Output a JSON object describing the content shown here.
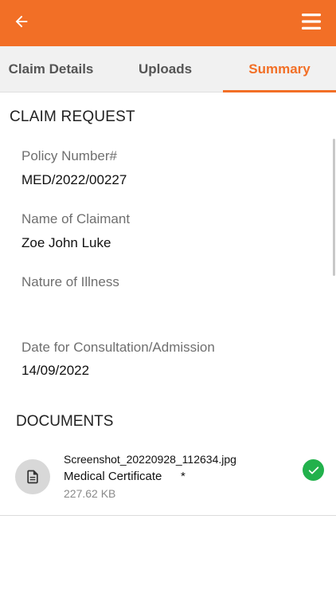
{
  "colors": {
    "brand": "#f26f26",
    "tab_bar": "#f1f1f1",
    "success": "#22b14c"
  },
  "appbar": {
    "back_icon": "arrow-left-icon",
    "menu_icon": "hamburger-menu-icon"
  },
  "tabs": [
    {
      "label": "Claim Details",
      "active": false
    },
    {
      "label": "Uploads",
      "active": false
    },
    {
      "label": "Summary",
      "active": true
    }
  ],
  "claim_request": {
    "title": "CLAIM REQUEST",
    "fields": [
      {
        "label": "Policy Number#",
        "value": "MED/2022/00227"
      },
      {
        "label": "Name of Claimant",
        "value": "Zoe John Luke"
      },
      {
        "label": "Nature of Illness",
        "value": ""
      },
      {
        "label": "Date for Consultation/Admission",
        "value": "14/09/2022"
      }
    ]
  },
  "documents": {
    "title": "DOCUMENTS",
    "items": [
      {
        "filename": "Screenshot_20220928_112634.jpg",
        "type": "Medical Certificate",
        "required_marker": "*",
        "size": "227.62 KB",
        "icon": "document-icon",
        "status_icon": "check-circle-icon"
      }
    ]
  }
}
